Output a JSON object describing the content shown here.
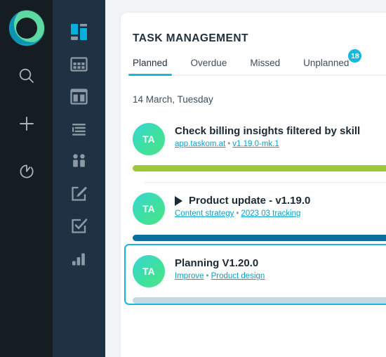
{
  "theme": {
    "rail_primary_bg": "#151c22",
    "rail_secondary_bg": "#1f3243",
    "page_bg": "#f1f3f4",
    "panel_bg": "#ffffff",
    "accent_cyan": "#17b8dc",
    "link_color": "#0e9fc4",
    "title_color": "#1d2a34",
    "avatar_gradient_from": "#38d6d6",
    "avatar_gradient_to": "#4ce489",
    "logo_left_color": "#0e93b5",
    "logo_right_color": "#5fd9a4"
  },
  "rail_primary": {
    "logo": "app-logo",
    "buttons": [
      {
        "icon": "search-icon",
        "label": "Search"
      },
      {
        "icon": "plus-icon",
        "label": "Add"
      },
      {
        "icon": "timer-icon",
        "label": "Timer"
      }
    ]
  },
  "rail_secondary": {
    "items": [
      {
        "icon": "dashboard-icon",
        "label": "Dashboard",
        "active": true
      },
      {
        "icon": "grid-table-icon",
        "label": "Table",
        "active": false
      },
      {
        "icon": "columns-icon",
        "label": "Columns",
        "active": false
      },
      {
        "icon": "list-icon",
        "label": "List",
        "active": false
      },
      {
        "icon": "apps-icon",
        "label": "Apps",
        "active": false
      },
      {
        "icon": "edit-icon",
        "label": "Edit",
        "active": false
      },
      {
        "icon": "checklist-icon",
        "label": "Checklist",
        "active": false
      },
      {
        "icon": "bar-chart-icon",
        "label": "Reports",
        "active": false
      }
    ]
  },
  "panel": {
    "title": "TASK MANAGEMENT",
    "tabs": [
      {
        "label": "Planned",
        "active": true,
        "badge": null
      },
      {
        "label": "Overdue",
        "active": false,
        "badge": null
      },
      {
        "label": "Missed",
        "active": false,
        "badge": null
      },
      {
        "label": "Unplanned",
        "active": false,
        "badge": "18"
      }
    ],
    "date_label": "14 March, Tuesday",
    "tasks": [
      {
        "avatar_initials": "TA",
        "title": "Check billing insights filtered by skill",
        "has_play_icon": false,
        "meta_links": [
          "app.taskom.at",
          "v1.19.0-mk.1"
        ],
        "meta_separator": "•",
        "progress_color": "green",
        "selected": false
      },
      {
        "avatar_initials": "TA",
        "title": "Product update - v1.19.0",
        "has_play_icon": true,
        "meta_links": [
          "Content strategy",
          "2023 03 tracking"
        ],
        "meta_separator": "•",
        "progress_color": "blue",
        "selected": false
      },
      {
        "avatar_initials": "TA",
        "title": "Planning V1.20.0",
        "has_play_icon": false,
        "meta_links": [
          "Improve",
          "Product design"
        ],
        "meta_separator": "•",
        "progress_color": "grey",
        "selected": true
      }
    ]
  }
}
